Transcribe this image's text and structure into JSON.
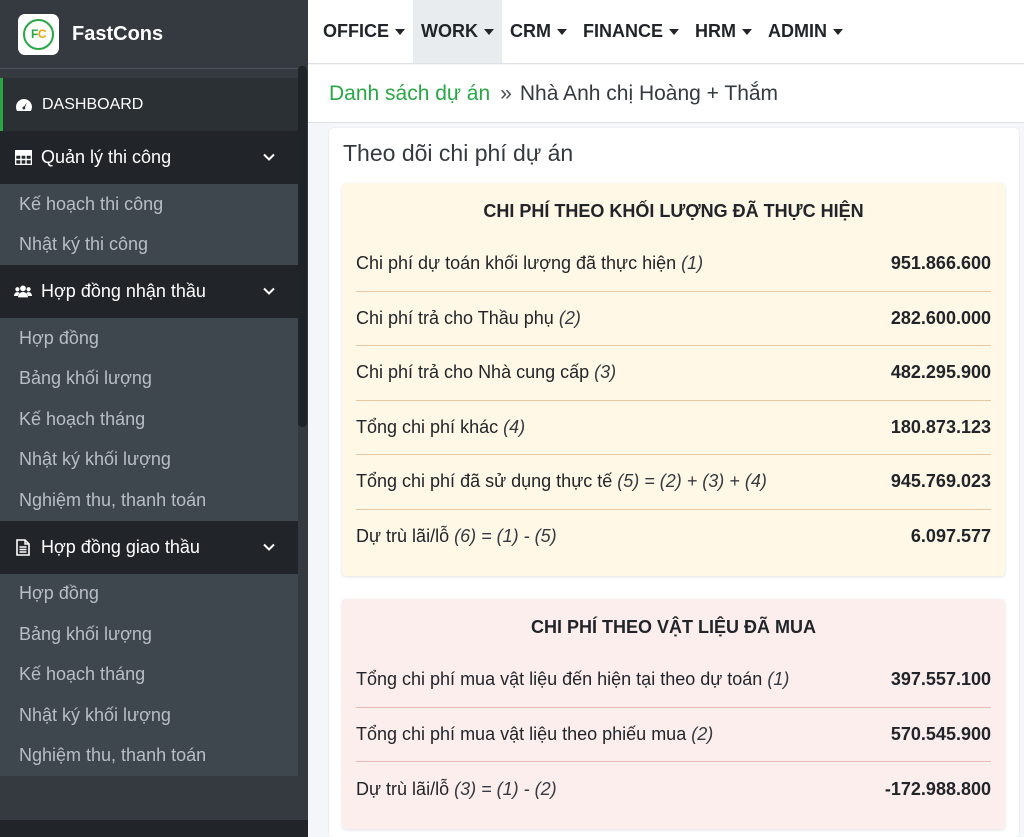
{
  "app": {
    "logo_text_f": "F",
    "logo_text_c": "C",
    "name": "FastCons"
  },
  "sidebar": {
    "dashboard": "DASHBOARD",
    "groups": [
      {
        "label": "Quản lý thi công",
        "items": [
          "Kế hoạch thi công",
          "Nhật ký thi công"
        ]
      },
      {
        "label": "Hợp đồng nhận thầu",
        "items": [
          "Hợp đồng",
          "Bảng khối lượng",
          "Kế hoạch tháng",
          "Nhật ký khối lượng",
          "Nghiệm thu, thanh toán"
        ]
      },
      {
        "label": "Hợp đồng giao thầu",
        "items": [
          "Hợp đồng",
          "Bảng khối lượng",
          "Kế hoạch tháng",
          "Nhật ký khối lượng",
          "Nghiệm thu, thanh toán"
        ]
      }
    ]
  },
  "topnav": [
    "OFFICE",
    "WORK",
    "CRM",
    "FINANCE",
    "HRM",
    "ADMIN"
  ],
  "breadcrumb": {
    "link": "Danh sách dự án",
    "sep": "»",
    "current": "Nhà Anh chị Hoàng + Thắm"
  },
  "card": {
    "title": "Theo dõi chi phí dự án",
    "section1": {
      "heading": "CHI PHÍ THEO KHỐI LƯỢNG ĐÃ THỰC HIỆN",
      "rows": [
        {
          "label": "Chi phí dự toán khối lượng đã thực hiện",
          "note": "(1)",
          "value": "951.866.600"
        },
        {
          "label": "Chi phí trả cho Thầu phụ",
          "note": "(2)",
          "value": "282.600.000"
        },
        {
          "label": "Chi phí trả cho Nhà cung cấp",
          "note": "(3)",
          "value": "482.295.900"
        },
        {
          "label": "Tổng chi phí khác",
          "note": "(4)",
          "value": "180.873.123"
        },
        {
          "label": "Tổng chi phí đã sử dụng thực tế",
          "note": "(5) = (2) + (3) + (4)",
          "value": "945.769.023"
        },
        {
          "label": "Dự trù lãi/lỗ",
          "note": "(6) = (1) - (5)",
          "value": "6.097.577"
        }
      ]
    },
    "section2": {
      "heading": "CHI PHÍ THEO VẬT LIỆU ĐÃ MUA",
      "rows": [
        {
          "label": "Tổng chi phí mua vật liệu đến hiện tại theo dự toán",
          "note": "(1)",
          "value": "397.557.100"
        },
        {
          "label": "Tổng chi phí mua vật liệu theo phiếu mua",
          "note": "(2)",
          "value": "570.545.900"
        },
        {
          "label": "Dự trù lãi/lỗ",
          "note": "(3) = (1) - (2)",
          "value": "-172.988.800"
        }
      ]
    }
  }
}
